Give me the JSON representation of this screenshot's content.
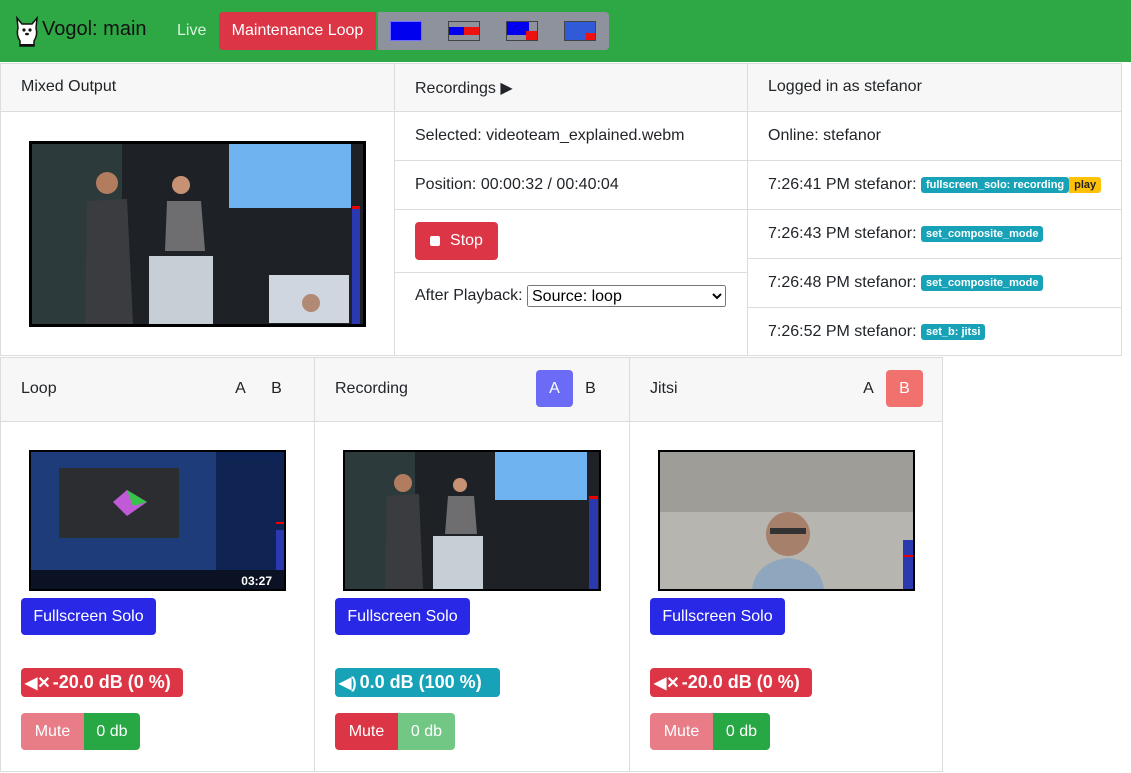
{
  "header": {
    "brand": "Vogol: main",
    "live": "Live",
    "maintenance": "Maintenance Loop",
    "mode_icons": [
      "fullscreen-mode-icon",
      "side-by-side-mode-icon",
      "picture-in-picture-mode-icon",
      "lecture-mode-icon"
    ],
    "color": "#2ea844"
  },
  "mixed": {
    "title": "Mixed Output"
  },
  "recordings": {
    "title": "Recordings ▶",
    "selected": "Selected: videoteam_explained.webm",
    "position": "Position: 00:00:32 / 00:40:04",
    "stop": "Stop",
    "after_label": "After Playback:",
    "after_value": "Source: loop"
  },
  "log": {
    "title": "Logged in as stefanor",
    "online": "Online: stefanor",
    "entries": [
      {
        "text": "7:26:41 PM stefanor:",
        "badge": "fullscreen_solo: recording",
        "extra": "play"
      },
      {
        "text": "7:26:43 PM stefanor:",
        "badge": "set_composite_mode"
      },
      {
        "text": "7:26:48 PM stefanor:",
        "badge": "set_composite_mode"
      },
      {
        "text": "7:26:52 PM stefanor:",
        "badge": "set_b: jitsi"
      }
    ]
  },
  "sources": [
    {
      "title": "Loop",
      "a": "A",
      "b": "B",
      "fs": "Fullscreen Solo",
      "volume": "-20.0 dB (0 %)",
      "mute": "Mute",
      "zero": "0 db",
      "timecode": "03:27"
    },
    {
      "title": "Recording",
      "a": "A",
      "b": "B",
      "fs": "Fullscreen Solo",
      "volume": "0.0 dB (100 %)",
      "mute": "Mute",
      "zero": "0 db"
    },
    {
      "title": "Jitsi",
      "a": "A",
      "b": "B",
      "fs": "Fullscreen Solo",
      "volume": "-20.0 dB (0 %)",
      "mute": "Mute",
      "zero": "0 db"
    }
  ]
}
